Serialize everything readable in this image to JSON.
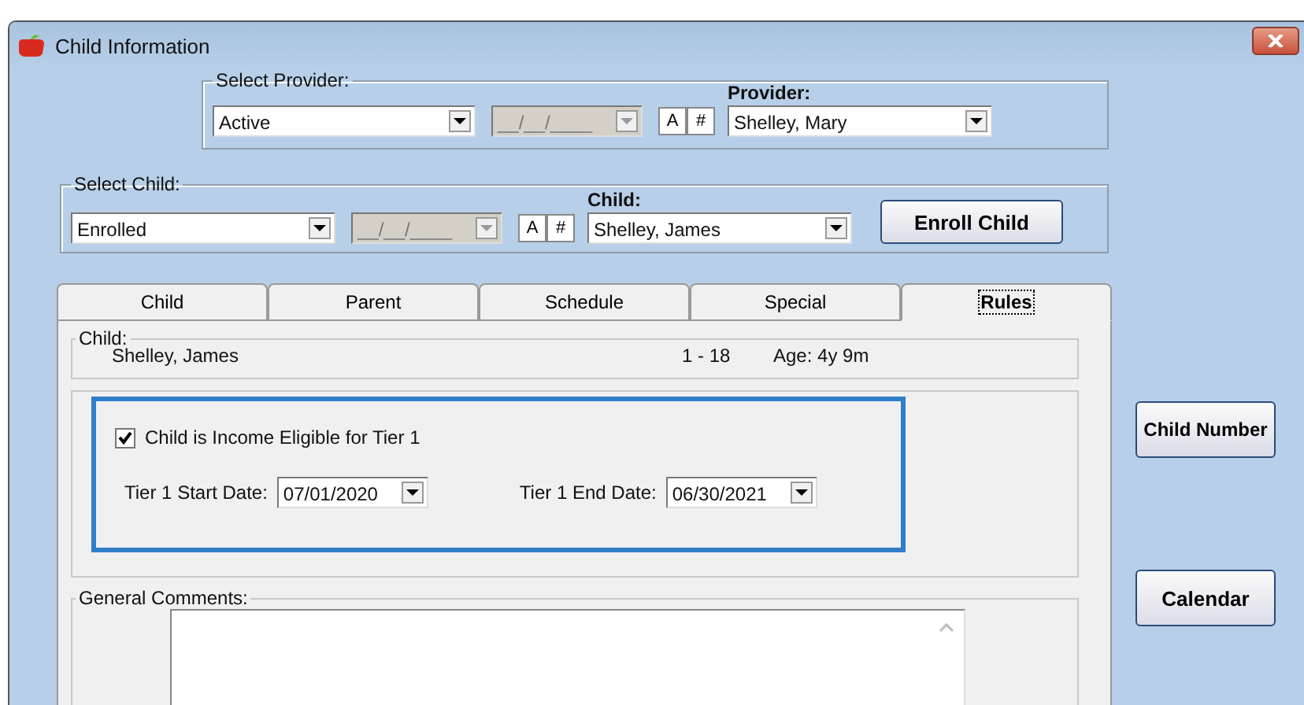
{
  "window": {
    "title": "Child Information"
  },
  "provider_group": {
    "legend": "Select Provider:",
    "status": "Active",
    "date": {
      "value": "__/__/____",
      "disabled": true
    },
    "sort_buttons": [
      "A",
      "#"
    ],
    "provider_label": "Provider:",
    "provider": "Shelley, Mary"
  },
  "child_group": {
    "legend": "Select Child:",
    "status": "Enrolled",
    "date": {
      "value": "__/__/____",
      "disabled": true
    },
    "sort_buttons": [
      "A",
      "#"
    ],
    "child_label": "Child:",
    "child": "Shelley, James",
    "enroll_button": "Enroll Child"
  },
  "tabs": [
    {
      "label": "Child",
      "selected": false
    },
    {
      "label": "Parent",
      "selected": false
    },
    {
      "label": "Schedule",
      "selected": false
    },
    {
      "label": "Special",
      "selected": false
    },
    {
      "label": "Rules",
      "selected": true
    }
  ],
  "child_info": {
    "legend": "Child:",
    "name": "Shelley, James",
    "range": "1 - 18",
    "age": "Age: 4y 9m"
  },
  "tier": {
    "checkbox": {
      "label": "Child is Income Eligible for Tier 1",
      "checked": true
    },
    "start_label": "Tier 1 Start Date:",
    "start_date": "07/01/2020",
    "end_label": "Tier 1 End Date:",
    "end_date": "06/30/2021"
  },
  "comments": {
    "legend": "General Comments:"
  },
  "side_buttons": [
    "Child Number",
    "Calendar"
  ]
}
